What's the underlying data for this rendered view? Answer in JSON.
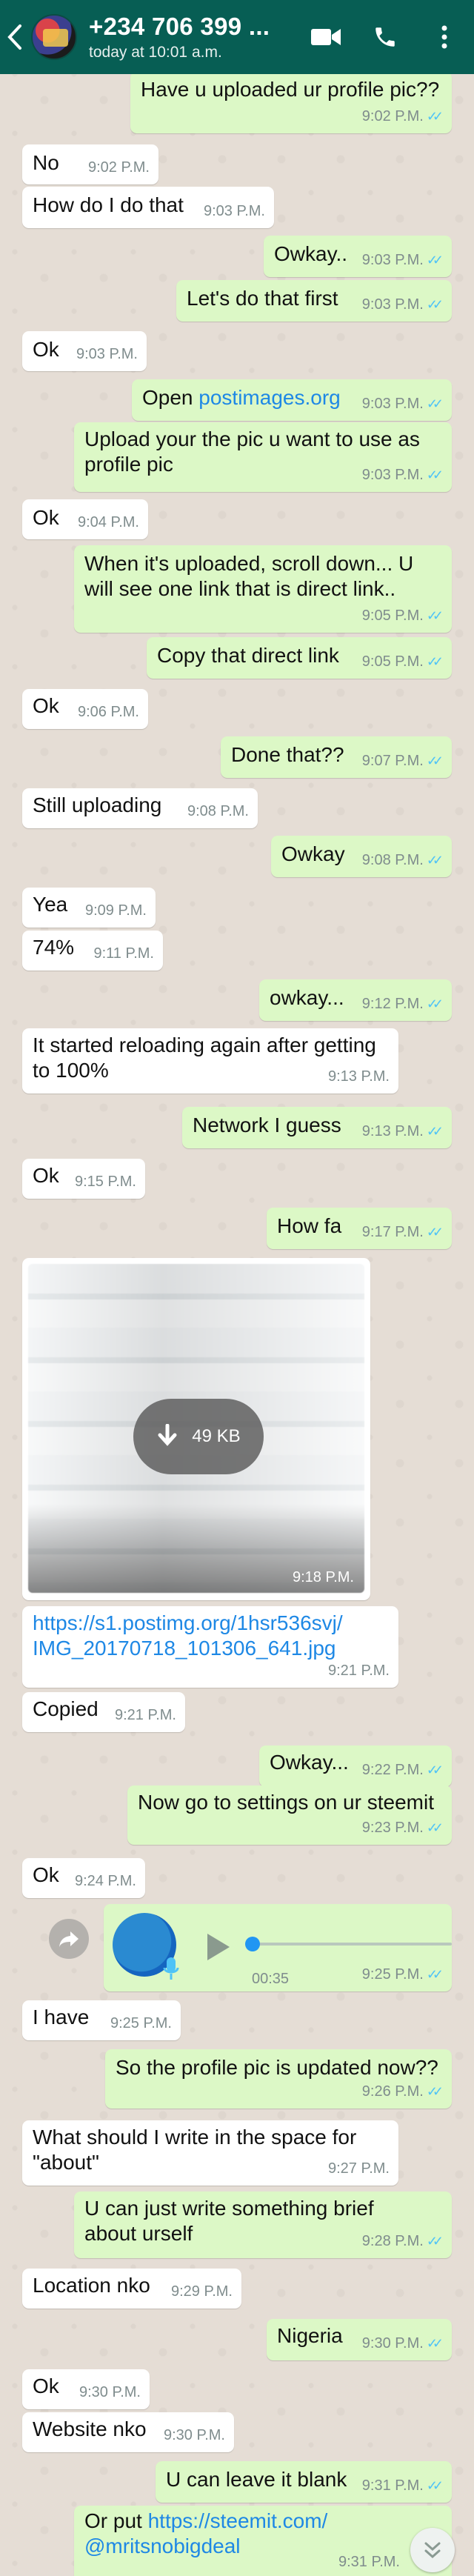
{
  "header": {
    "contact_name": "+234 706 399 ...",
    "status": "today at 10:01 a.m.",
    "icons": [
      "back-icon",
      "avatar",
      "video-call-icon",
      "voice-call-icon",
      "more-options-icon"
    ]
  },
  "colors": {
    "header": "#075e54",
    "incoming_bubble": "#ffffff",
    "outgoing_bubble": "#dcf8c6",
    "read_ticks": "#4fc3f7",
    "link": "#1e88e5"
  },
  "messages": [
    {
      "dir": "out",
      "text": "Have u uploaded ur profile pic??",
      "time": "9:02 P.M."
    },
    {
      "dir": "in",
      "text": "No",
      "time": "9:02 P.M."
    },
    {
      "dir": "in",
      "text": "How do I do that",
      "time": "9:03 P.M."
    },
    {
      "dir": "out",
      "text": "Owkay..",
      "time": "9:03 P.M."
    },
    {
      "dir": "out",
      "text": "Let's do that first",
      "time": "9:03 P.M."
    },
    {
      "dir": "in",
      "text": "Ok",
      "time": "9:03 P.M."
    },
    {
      "dir": "out",
      "text_prefix": "Open ",
      "link": "postimages.org",
      "time": "9:03 P.M."
    },
    {
      "dir": "out",
      "line1": "Upload your the pic u want to use as",
      "line2": "profile pic",
      "time": "9:03 P.M."
    },
    {
      "dir": "in",
      "text": "Ok",
      "time": "9:04 P.M."
    },
    {
      "dir": "out",
      "line1": "When it's uploaded, scroll down... U",
      "line2": "will see one link that is direct link..",
      "time": "9:05 P.M."
    },
    {
      "dir": "out",
      "text": "Copy that direct link",
      "time": "9:05 P.M."
    },
    {
      "dir": "in",
      "text": "Ok",
      "time": "9:06 P.M."
    },
    {
      "dir": "out",
      "text": "Done that??",
      "time": "9:07 P.M."
    },
    {
      "dir": "in",
      "text": "Still uploading",
      "time": "9:08 P.M."
    },
    {
      "dir": "out",
      "text": "Owkay",
      "time": "9:08 P.M."
    },
    {
      "dir": "in",
      "text": "Yea",
      "time": "9:09 P.M."
    },
    {
      "dir": "in",
      "text": "74%",
      "time": "9:11 P.M."
    },
    {
      "dir": "out",
      "text": "owkay...",
      "time": "9:12 P.M."
    },
    {
      "dir": "in",
      "line1": "It started reloading again after getting",
      "line2": "to 100%",
      "time": "9:13 P.M."
    },
    {
      "dir": "out",
      "text": "Network I guess",
      "time": "9:13 P.M."
    },
    {
      "dir": "in",
      "text": "Ok",
      "time": "9:15 P.M."
    },
    {
      "dir": "out",
      "text": "How fa",
      "time": "9:17 P.M."
    },
    {
      "dir": "in",
      "type": "image",
      "size": "49 KB",
      "time": "9:18 P.M."
    },
    {
      "dir": "in",
      "link1": "https://s1.postimg.org/1hsr536svj/",
      "link2": "IMG_20170718_101306_641.jpg",
      "time": "9:21 P.M."
    },
    {
      "dir": "in",
      "text": "Copied",
      "time": "9:21 P.M."
    },
    {
      "dir": "out",
      "text": "Owkay...",
      "time": "9:22 P.M."
    },
    {
      "dir": "out",
      "text": "Now go to settings on ur steemit",
      "time": "9:23 P.M."
    },
    {
      "dir": "in",
      "text": "Ok",
      "time": "9:24 P.M."
    },
    {
      "dir": "out",
      "type": "voice",
      "duration": "00:35",
      "time": "9:25 P.M."
    },
    {
      "dir": "in",
      "text": "I have",
      "time": "9:25 P.M."
    },
    {
      "dir": "out",
      "text": "So the profile pic is updated now??",
      "time": "9:26 P.M."
    },
    {
      "dir": "in",
      "line1": "What should I write in the space for",
      "line2": "\"about\"",
      "time": "9:27 P.M."
    },
    {
      "dir": "out",
      "line1": "U can just write something brief",
      "line2": "about urself",
      "time": "9:28 P.M."
    },
    {
      "dir": "in",
      "text": "Location nko",
      "time": "9:29 P.M."
    },
    {
      "dir": "out",
      "text": "Nigeria",
      "time": "9:30 P.M."
    },
    {
      "dir": "in",
      "text": "Ok",
      "time": "9:30 P.M."
    },
    {
      "dir": "in",
      "text": "Website nko",
      "time": "9:30 P.M."
    },
    {
      "dir": "out",
      "text": "U can leave it blank",
      "time": "9:31 P.M."
    },
    {
      "dir": "out",
      "line1_prefix": "Or put ",
      "link1": "https://steemit.com/",
      "link2": "@mritsnobigdeal",
      "time": "9:31 P.M."
    }
  ]
}
